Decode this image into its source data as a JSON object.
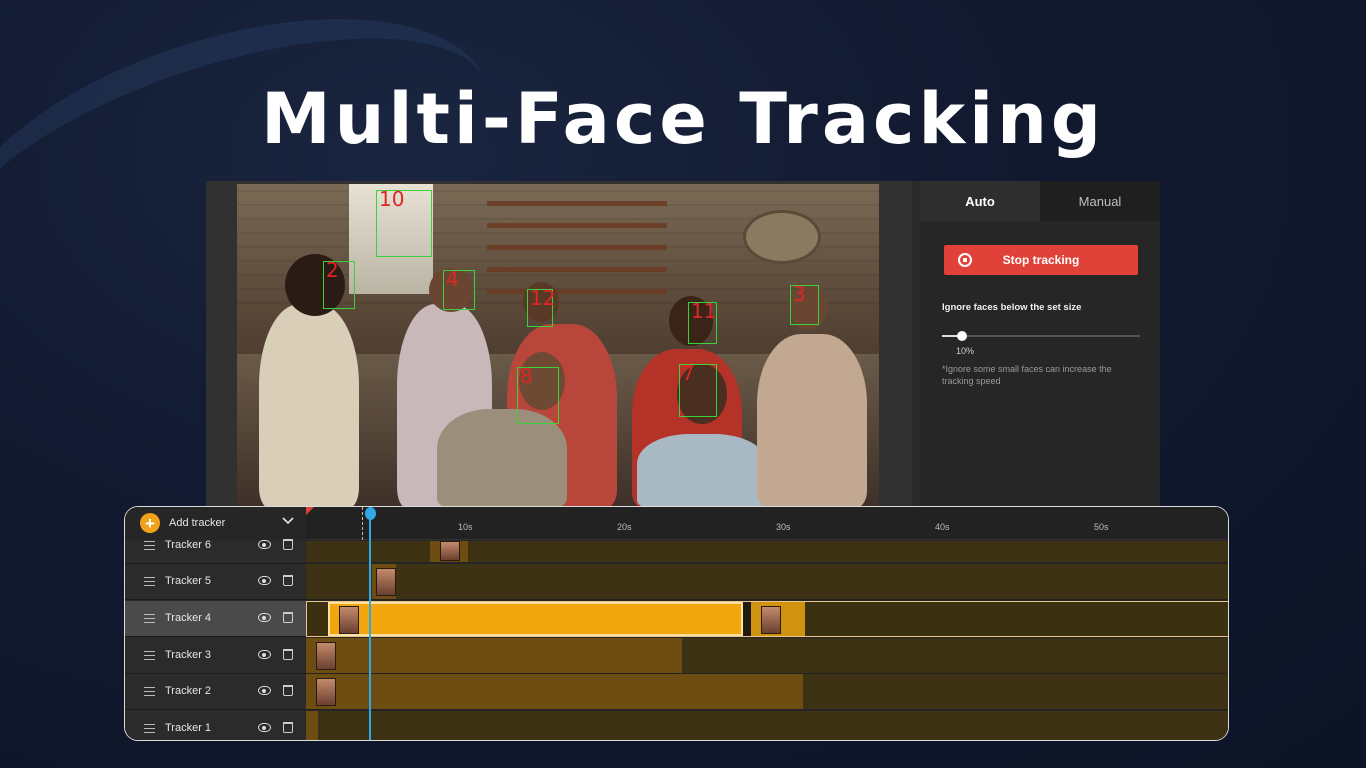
{
  "headline": "Multi-Face Tracking",
  "video": {
    "faces": [
      {
        "id": "10"
      },
      {
        "id": "2"
      },
      {
        "id": "4"
      },
      {
        "id": "12"
      },
      {
        "id": "11"
      },
      {
        "id": "3"
      },
      {
        "id": "8"
      },
      {
        "id": "7"
      }
    ]
  },
  "panel": {
    "tab_auto": "Auto",
    "tab_manual": "Manual",
    "stop_label": "Stop tracking",
    "ignore_label": "Ignore faces below the set size",
    "slider_value": "10%",
    "slider_fraction": 0.1,
    "hint": "*Ignore some small faces can increase the tracking speed"
  },
  "timeline": {
    "add_tracker": "Add tracker",
    "ticks": [
      "10s",
      "20s",
      "30s",
      "40s",
      "50s"
    ],
    "trackers": [
      {
        "name": "Tracker 6"
      },
      {
        "name": "Tracker 5"
      },
      {
        "name": "Tracker 4"
      },
      {
        "name": "Tracker 3"
      },
      {
        "name": "Tracker 2"
      },
      {
        "name": "Tracker 1"
      }
    ]
  },
  "colors": {
    "accent": "#f0a21a",
    "stop": "#e0423a",
    "face_box": "#3bd13b",
    "face_number": "#e02525",
    "playhead": "#2fa8e8"
  }
}
